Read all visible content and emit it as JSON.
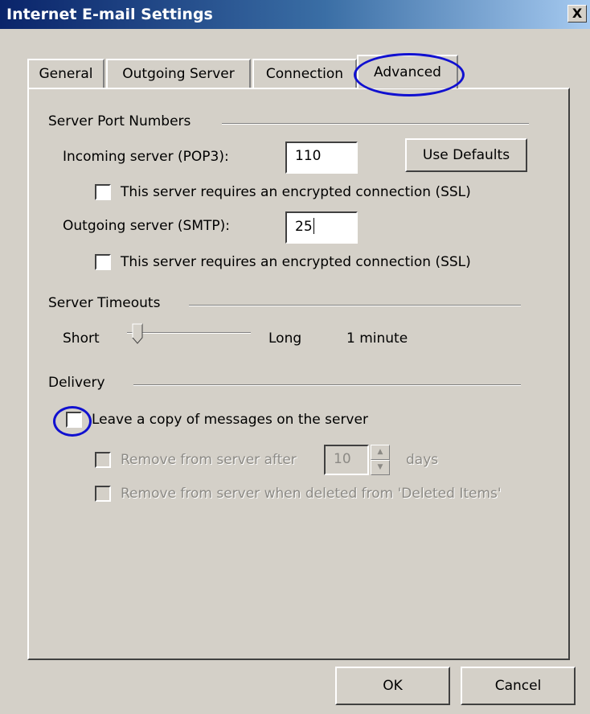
{
  "window": {
    "title": "Internet E-mail Settings",
    "close_label": "X"
  },
  "tabs": [
    {
      "label": "General",
      "active": false
    },
    {
      "label": "Outgoing Server",
      "active": false
    },
    {
      "label": "Connection",
      "active": false
    },
    {
      "label": "Advanced",
      "active": true
    }
  ],
  "server_ports": {
    "group_label": "Server Port Numbers",
    "incoming_label": "Incoming server (POP3):",
    "incoming_value": "110",
    "use_defaults_label": "Use Defaults",
    "incoming_ssl_label": "This server requires an encrypted connection (SSL)",
    "incoming_ssl_checked": false,
    "outgoing_label": "Outgoing server (SMTP):",
    "outgoing_value": "25",
    "outgoing_ssl_label": "This server requires an encrypted connection (SSL)",
    "outgoing_ssl_checked": false
  },
  "server_timeouts": {
    "group_label": "Server Timeouts",
    "short_label": "Short",
    "long_label": "Long",
    "value_label": "1 minute",
    "slider_level": 0.1
  },
  "delivery": {
    "group_label": "Delivery",
    "leave_copy_label": "Leave a copy of messages on the server",
    "leave_copy_checked": false,
    "remove_after_label": "Remove from server after",
    "remove_after_value": "10",
    "days_label": "days",
    "remove_deleted_label": "Remove from server when deleted from 'Deleted Items'"
  },
  "footer": {
    "ok_label": "OK",
    "cancel_label": "Cancel"
  },
  "colors": {
    "dialog_bg": "#d4d0c8",
    "title_start": "#0a246a",
    "title_end": "#a6caf0",
    "highlight_circle": "#1010d0"
  }
}
